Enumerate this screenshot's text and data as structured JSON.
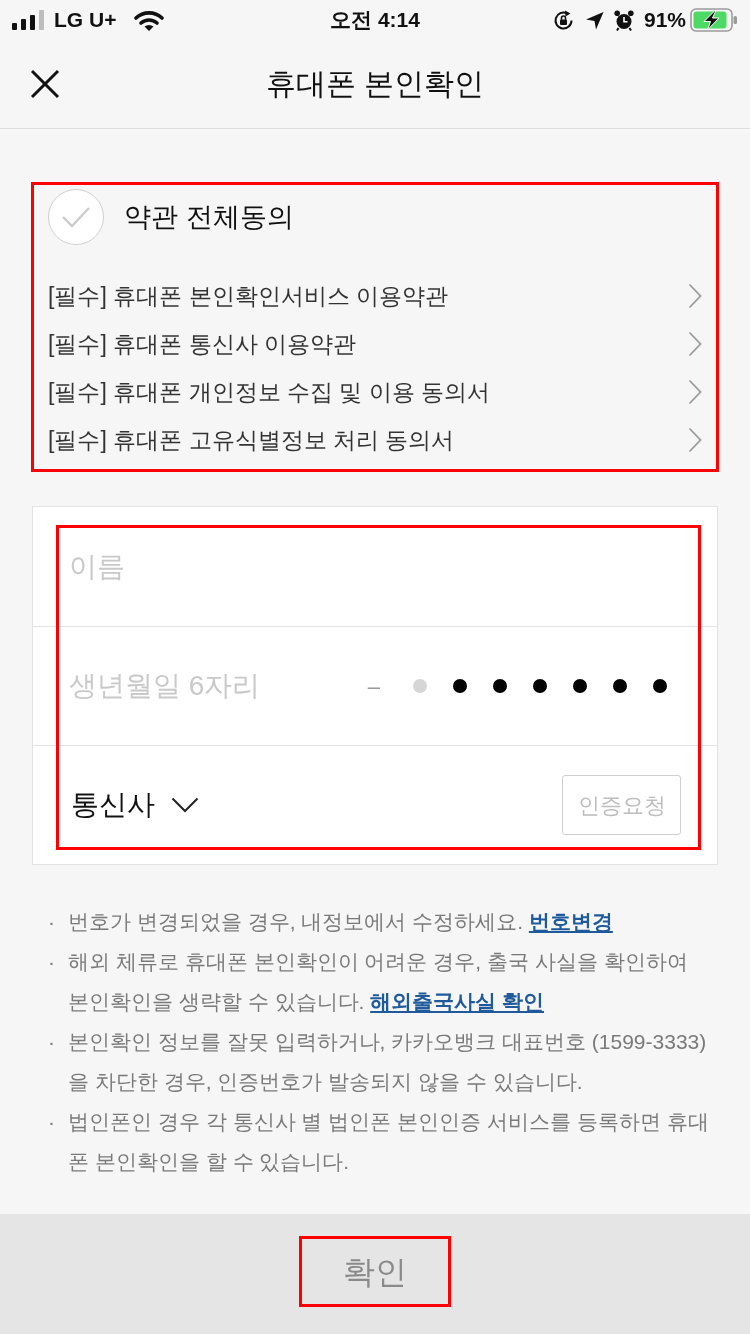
{
  "status_bar": {
    "carrier": "LG U+",
    "time": "오전 4:14",
    "battery": "91%"
  },
  "header": {
    "title": "휴대폰 본인확인"
  },
  "agreement": {
    "highlighted": true,
    "all": {
      "label": "약관 전체동의",
      "checked": false
    },
    "terms": [
      {
        "label": "[필수] 휴대폰 본인확인서비스 이용약관"
      },
      {
        "label": "[필수] 휴대폰 통신사 이용약관"
      },
      {
        "label": "[필수] 휴대폰 개인정보 수집 및 이용 동의서"
      },
      {
        "label": "[필수] 휴대폰 고유식별정보 처리 동의서"
      }
    ]
  },
  "form": {
    "highlighted": true,
    "name": {
      "placeholder": "이름"
    },
    "birthdate": {
      "placeholder": "생년월일 6자리",
      "separator": "–",
      "mask_dots": [
        {
          "filled": false
        },
        {
          "filled": true
        },
        {
          "filled": true
        },
        {
          "filled": true
        },
        {
          "filled": true
        },
        {
          "filled": true
        },
        {
          "filled": true
        }
      ]
    },
    "carrier": {
      "label": "통신사"
    },
    "request_button": {
      "label": "인증요청",
      "disabled": true
    }
  },
  "notes": [
    {
      "bullet": "·",
      "text": "번호가 변경되었을 경우, 내정보에서 수정하세요.",
      "link": "번호변경"
    },
    {
      "bullet": "·",
      "text": "해외 체류로 휴대폰 본인확인이 어려운 경우, 출국 사실을 확인하여 본인확인을 생략할 수 있습니다.",
      "link": "해외출국사실 확인"
    },
    {
      "bullet": "·",
      "text": "본인확인 정보를 잘못 입력하거나, 카카오뱅크 대표번호 (1599-3333)을 차단한 경우, 인증번호가 발송되지 않을 수 있습니다."
    },
    {
      "bullet": "·",
      "text": "법인폰인 경우 각 통신사 별 법인폰 본인인증 서비스를 등록하면 휴대폰 본인확인을 할 수 있습니다."
    }
  ],
  "confirm_button": {
    "label": "확인",
    "disabled": true,
    "highlighted": true
  }
}
